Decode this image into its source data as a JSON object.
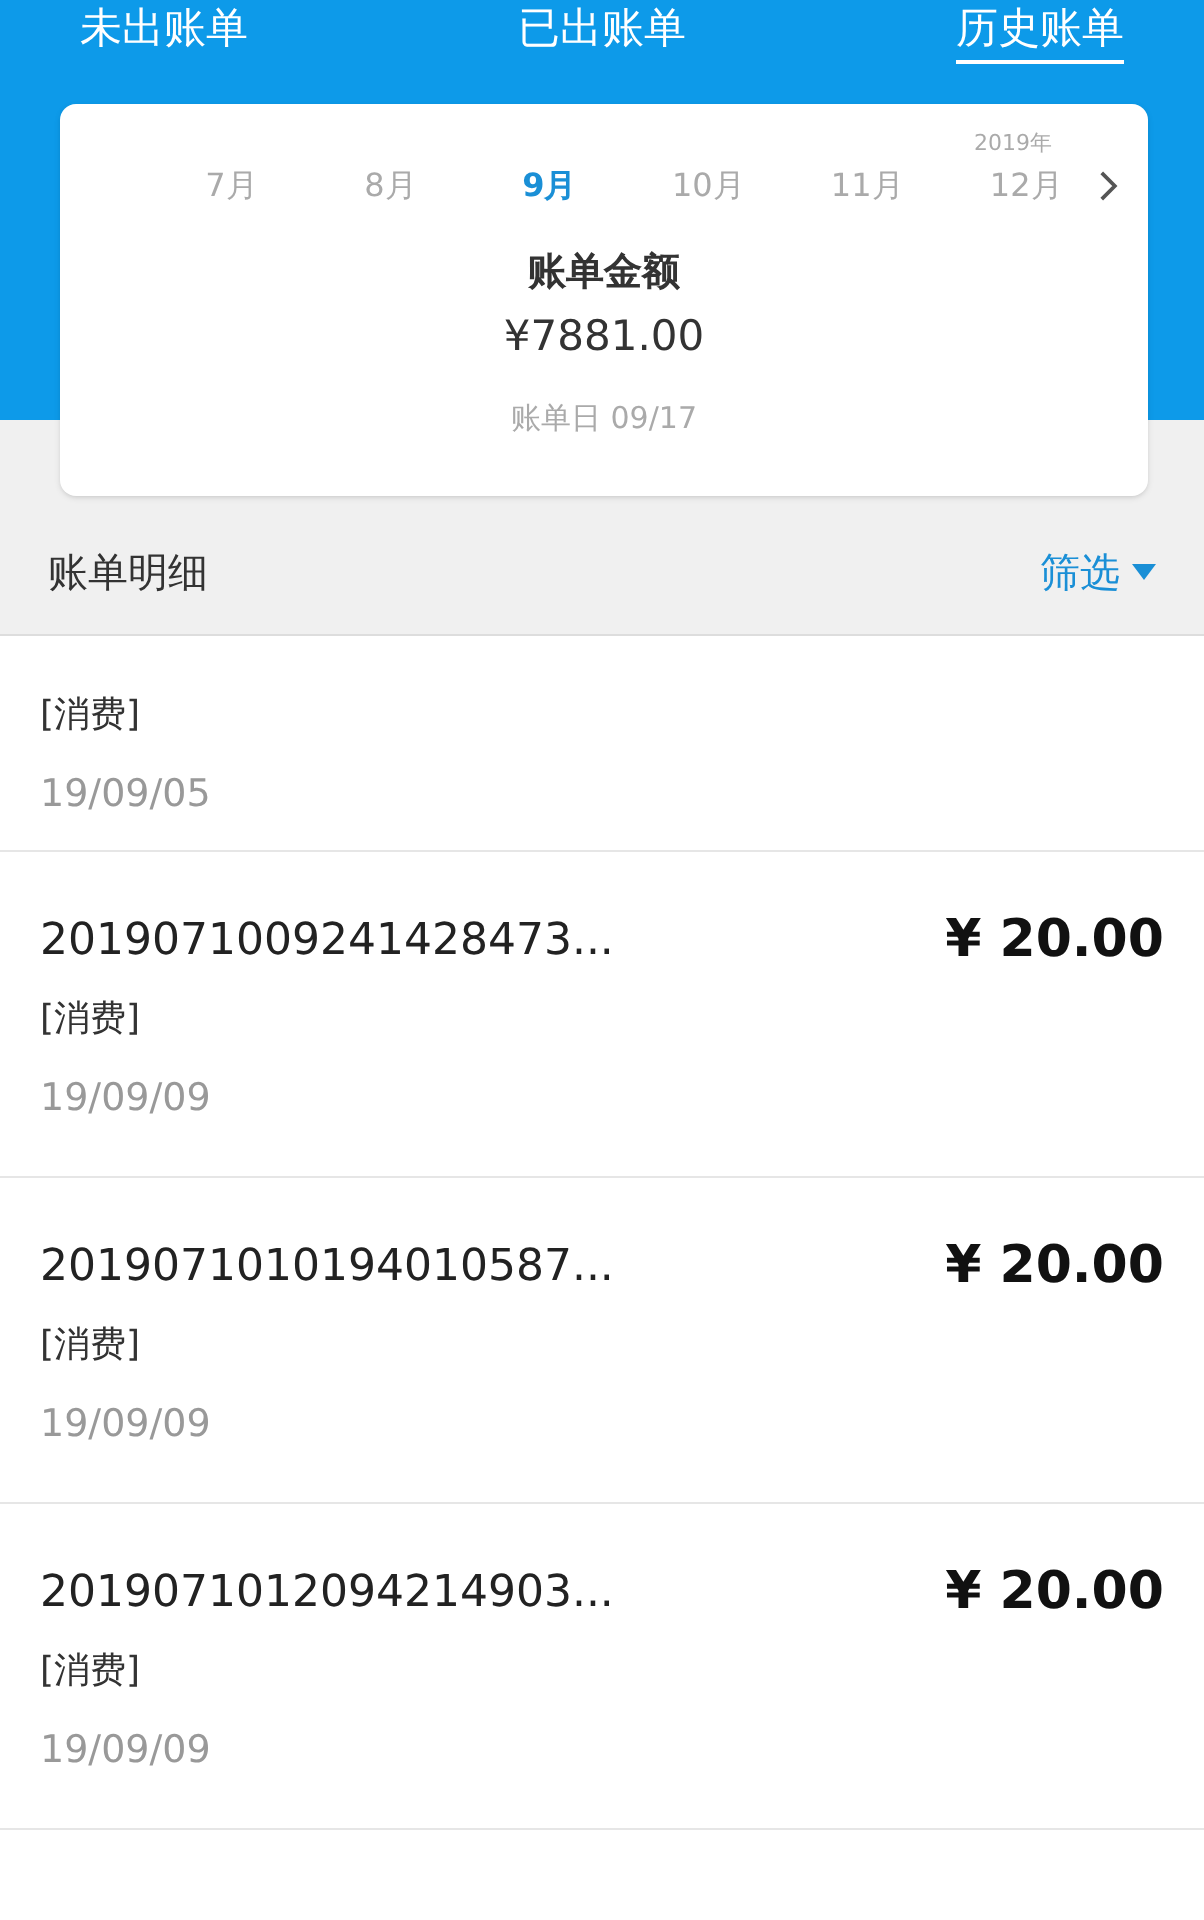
{
  "tabs": [
    {
      "label": "未出账单",
      "selected": false
    },
    {
      "label": "已出账单",
      "selected": false
    },
    {
      "label": "历史账单",
      "selected": true
    }
  ],
  "bill_card": {
    "year": "2019年",
    "months": [
      {
        "label": "7月",
        "selected": false
      },
      {
        "label": "8月",
        "selected": false
      },
      {
        "label": "9月",
        "selected": true
      },
      {
        "label": "10月",
        "selected": false
      },
      {
        "label": "11月",
        "selected": false
      },
      {
        "label": "12月",
        "selected": false
      }
    ],
    "amount_label": "账单金额",
    "amount": "¥7881.00",
    "bill_date": "账单日 09/17"
  },
  "details": {
    "title": "账单明细",
    "filter": "筛选"
  },
  "transactions": [
    {
      "type": "[消费]",
      "date": "19/09/05"
    },
    {
      "id": "2019071009241428473...",
      "amount": "¥ 20.00",
      "type": "[消费]",
      "date": "19/09/09"
    },
    {
      "id": "2019071010194010587...",
      "amount": "¥ 20.00",
      "type": "[消费]",
      "date": "19/09/09"
    },
    {
      "id": "2019071012094214903...",
      "amount": "¥ 20.00",
      "type": "[消费]",
      "date": "19/09/09"
    }
  ]
}
